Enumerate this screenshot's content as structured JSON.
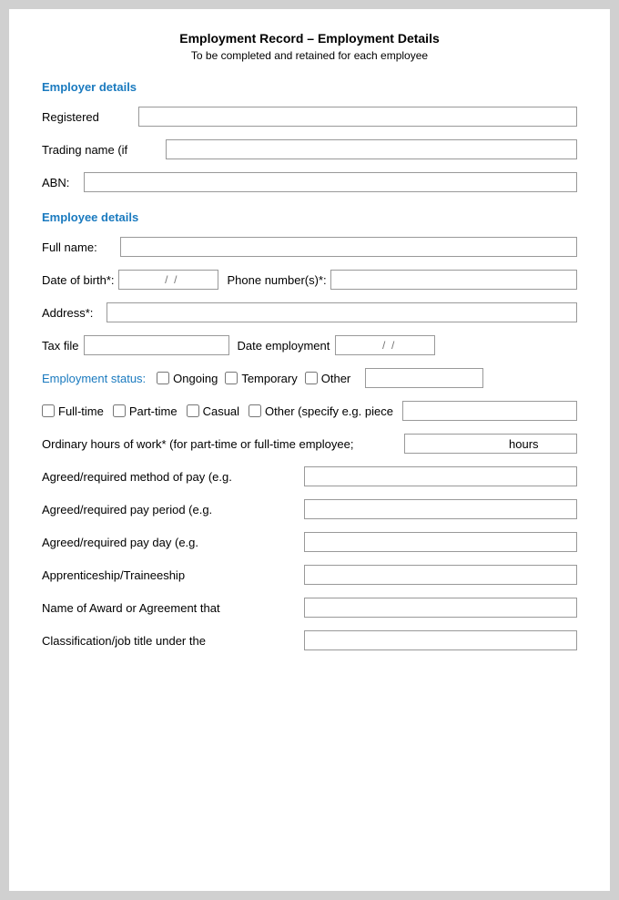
{
  "page": {
    "title": "Employment Record – Employment Details",
    "subtitle": "To be completed and retained for each employee"
  },
  "employer_section": {
    "heading": "Employer details",
    "registered_label": "Registered",
    "trading_label": "Trading name (if",
    "abn_label": "ABN:"
  },
  "employee_section": {
    "heading": "Employee details",
    "fullname_label": "Full name:",
    "dob_label": "Date of birth*:",
    "dob_separator1": "/",
    "dob_separator2": "/",
    "phone_label": "Phone number(s)*:",
    "address_label": "Address*:",
    "taxfile_label": "Tax file",
    "dateemployment_label": "Date employment",
    "dateemployment_sep1": "/",
    "dateemployment_sep2": "/",
    "empstatus_label": "Employment status:",
    "ongoing_label": "Ongoing",
    "temporary_label": "Temporary",
    "other_label": "Other",
    "fulltime_label": "Full-time",
    "parttime_label": "Part-time",
    "casual_label": "Casual",
    "otherwork_label": "Other (specify e.g. piece",
    "hours_label": "Ordinary hours of work* (for part-time or full-time employee;",
    "hours_suffix": "hours",
    "paymethod_label": "Agreed/required method of pay (e.g.",
    "payperiod_label": "Agreed/required pay period (e.g.",
    "payday_label": "Agreed/required pay day (e.g.",
    "apprenticeship_label": "Apprenticeship/Traineeship",
    "award_label": "Name of Award or Agreement that",
    "classification_label": "Classification/job title under the"
  }
}
